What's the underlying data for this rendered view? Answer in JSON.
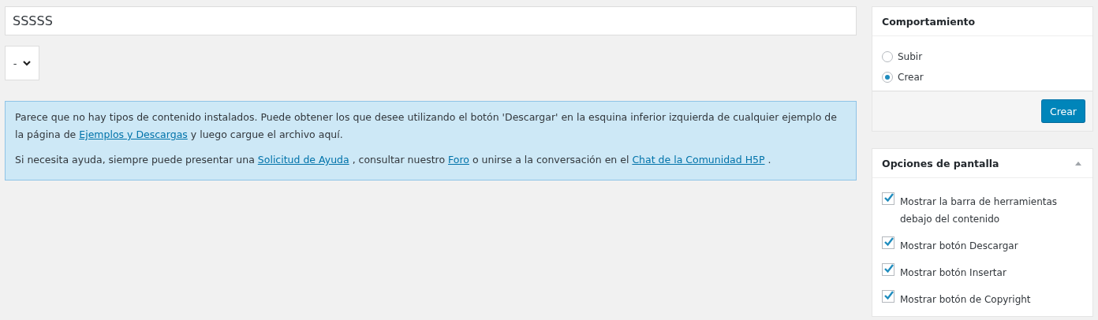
{
  "title_field": {
    "value": "SSSSS"
  },
  "select": {
    "value": "-"
  },
  "notice": {
    "paragraphs": [
      [
        {
          "kind": "text",
          "text": "Parece que no hay tipos de contenido instalados. Puede obtener los que desee utilizando el botón 'Descargar' en la esquina inferior izquierda de cualquier ejemplo de la página de "
        },
        {
          "kind": "link",
          "text": "Ejemplos y Descargas"
        },
        {
          "kind": "text",
          "text": " y luego cargue el archivo aquí."
        }
      ],
      [
        {
          "kind": "text",
          "text": "Si necesita ayuda, siempre puede presentar una "
        },
        {
          "kind": "link",
          "text": "Solicitud de Ayuda"
        },
        {
          "kind": "text",
          "text": " , consultar nuestro "
        },
        {
          "kind": "link",
          "text": "Foro"
        },
        {
          "kind": "text",
          "text": " o unirse a la conversación en el "
        },
        {
          "kind": "link",
          "text": "Chat de la Comunidad H5P"
        },
        {
          "kind": "text",
          "text": " ."
        }
      ]
    ]
  },
  "behaviour_box": {
    "title": "Comportamiento",
    "options": [
      {
        "label": "Subir",
        "selected": false
      },
      {
        "label": "Crear",
        "selected": true
      }
    ],
    "button": "Crear"
  },
  "screen_options_box": {
    "title": "Opciones de pantalla",
    "expanded": true,
    "options": [
      {
        "label": "Mostrar la barra de herramientas debajo del contenido",
        "checked": true
      },
      {
        "label": "Mostrar botón Descargar",
        "checked": true
      },
      {
        "label": "Mostrar botón Insertar",
        "checked": true
      },
      {
        "label": "Mostrar botón de Copyright",
        "checked": true
      }
    ]
  }
}
